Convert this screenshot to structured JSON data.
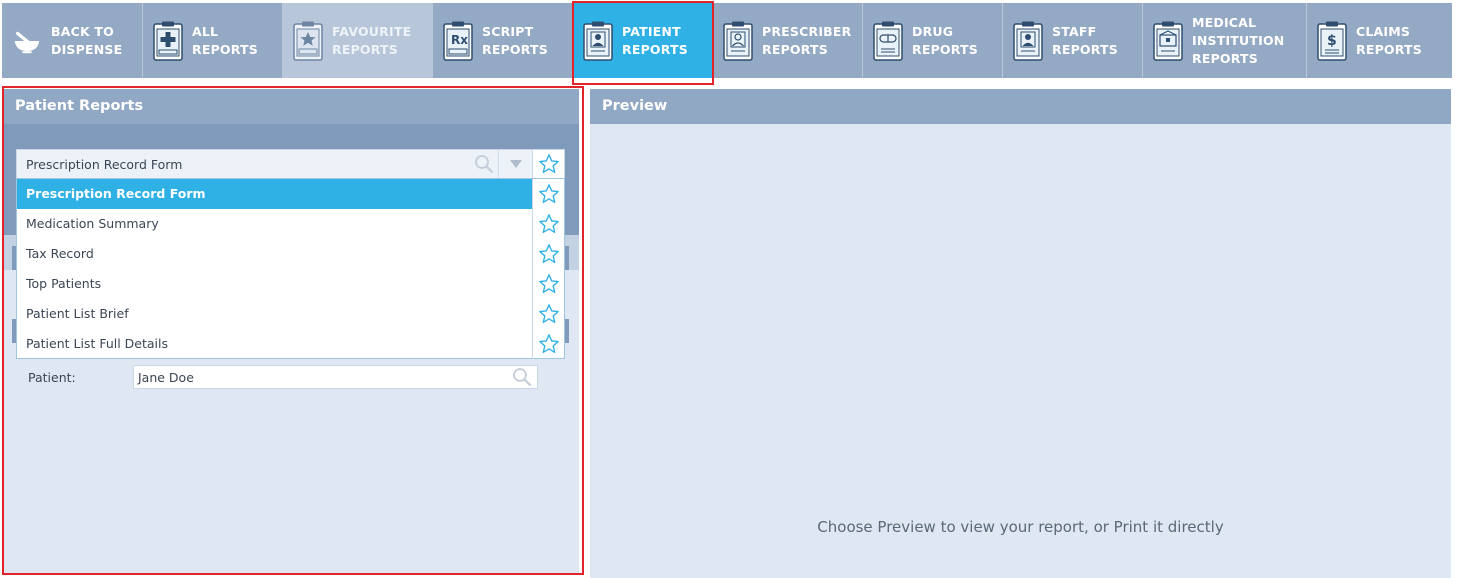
{
  "nav": {
    "items": [
      {
        "id": "back",
        "line1": "BACK TO",
        "line2": "DISPENSE",
        "icon": "mortar-pestle-icon"
      },
      {
        "id": "all",
        "line1": "ALL",
        "line2": "REPORTS",
        "icon": "clipboard-medical-cross-icon"
      },
      {
        "id": "favourite",
        "line1": "FAVOURITE",
        "line2": "REPORTS",
        "icon": "clipboard-star-icon"
      },
      {
        "id": "script",
        "line1": "SCRIPT",
        "line2": "REPORTS",
        "icon": "clipboard-rx-icon"
      },
      {
        "id": "patient",
        "line1": "PATIENT",
        "line2": "REPORTS",
        "icon": "clipboard-patient-icon"
      },
      {
        "id": "prescriber",
        "line1": "PRESCRIBER",
        "line2": "REPORTS",
        "icon": "clipboard-prescriber-icon"
      },
      {
        "id": "drug",
        "line1": "DRUG",
        "line2": "REPORTS",
        "icon": "clipboard-drug-icon"
      },
      {
        "id": "staff",
        "line1": "STAFF",
        "line2": "REPORTS",
        "icon": "clipboard-staff-icon"
      },
      {
        "id": "medical",
        "line1": "MEDICAL",
        "line2": "INSTITUTION",
        "line3": "REPORTS",
        "icon": "clipboard-institution-icon"
      },
      {
        "id": "claims",
        "line1": "CLAIMS",
        "line2": "REPORTS",
        "icon": "clipboard-dollar-icon"
      }
    ],
    "active": "patient"
  },
  "left_panel": {
    "title": "Patient Reports",
    "report_select": {
      "value": "Prescription Record Form",
      "options": [
        "Prescription Record Form",
        "Medication Summary",
        "Tax Record",
        "Top Patients",
        "Patient List Brief",
        "Patient List Full Details"
      ],
      "selected_index": 0
    },
    "patient": {
      "label": "Patient:",
      "value": "Jane Doe"
    }
  },
  "right_panel": {
    "title": "Preview",
    "message": "Choose Preview to view your report, or Print it directly"
  },
  "colors": {
    "nav_bg": "#94a9c4",
    "active": "#30b1e6",
    "highlight_outline": "#e2232a",
    "panel_bg": "#dfe8f2",
    "star": "#30b1e6"
  }
}
